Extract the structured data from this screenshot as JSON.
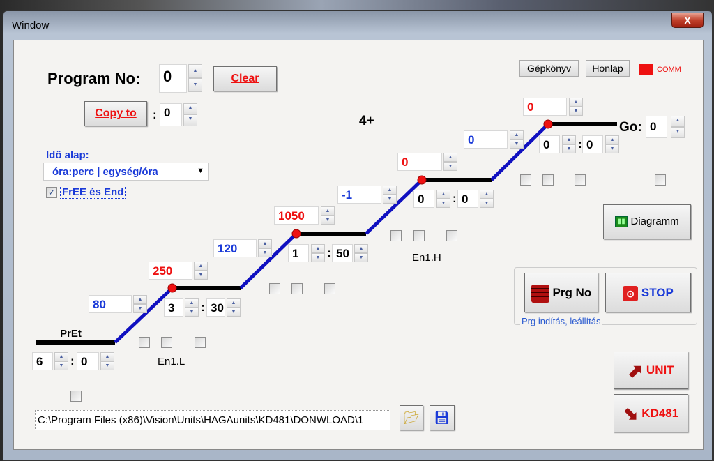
{
  "window": {
    "title": "Window",
    "close": "X"
  },
  "program": {
    "label": "Program No:",
    "value": "0",
    "clear": "Clear",
    "copy_to": "Copy to",
    "copy_sep": ":",
    "copy_value": "0"
  },
  "top_links": {
    "manual": "Gépkönyv",
    "homepage": "Honlap",
    "comm": "COMM",
    "comm_color": "#ee1111"
  },
  "segment_indicator": "4+",
  "time_base": {
    "label": "Idő alap:",
    "selected": "óra:perc | egység/óra",
    "free_end_checked": true,
    "free_end_label": "FrEE és End"
  },
  "pret": {
    "label": "PrEt",
    "h": "6",
    "m": "0"
  },
  "steps": [
    {
      "rate": "80",
      "temp": "250",
      "h": "3",
      "m": "30"
    },
    {
      "rate": "120",
      "temp": "1050",
      "h": "1",
      "m": "50"
    },
    {
      "rate": "-1",
      "temp": "0",
      "h": "0",
      "m": "0"
    },
    {
      "rate": "0",
      "temp": "0",
      "h": "0",
      "m": "0"
    }
  ],
  "event_labels": {
    "low": "En1.L",
    "high": "En1.H"
  },
  "go": {
    "label": "Go:",
    "value": "0"
  },
  "sep": ":",
  "buttons": {
    "diagram": "Diagramm",
    "prg_no": "Prg No",
    "stop": "STOP",
    "group_label": "Prg indítás, leállítás",
    "unit": "UNIT",
    "kd481": "KD481"
  },
  "file_path": "C:\\Program Files (x86)\\Vision\\Units\\HAGAunits\\KD481\\DONWLOAD\\1",
  "colors": {
    "rate": "#1a3ad8",
    "temp": "#ee1111",
    "ramp": "#1010c0",
    "hold": "#000000"
  }
}
